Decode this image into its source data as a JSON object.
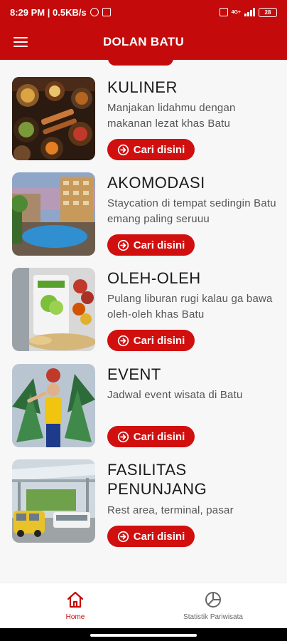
{
  "status_bar": {
    "time_speed": "8:29 PM | 0.5KB/s",
    "network_type": "4G+",
    "battery": "28"
  },
  "app_bar": {
    "title": "DOLAN BATU"
  },
  "cards": [
    {
      "title": "KULINER",
      "desc": "Manjakan lidahmu dengan makanan lezat khas Batu",
      "button": "Cari disini"
    },
    {
      "title": "AKOMODASI",
      "desc": "Staycation di tempat sedingin Batu emang paling seruuu",
      "button": "Cari disini"
    },
    {
      "title": "OLEH-OLEH",
      "desc": "Pulang liburan rugi kalau ga bawa oleh-oleh khas Batu",
      "button": "Cari disini"
    },
    {
      "title": "EVENT",
      "desc": "Jadwal event wisata di Batu",
      "button": "Cari disini"
    },
    {
      "title": "FASILITAS PENUNJANG",
      "desc": "Rest area, terminal, pasar",
      "button": "Cari disini"
    }
  ],
  "bottom_nav": {
    "items": [
      {
        "label": "Home",
        "icon": "home-icon",
        "active": true
      },
      {
        "label": "Statistik Pariwisata",
        "icon": "pie-chart-icon",
        "active": false
      }
    ]
  },
  "colors": {
    "primary": "#c40a0a",
    "button": "#d10f0f",
    "background": "#f7f7f7"
  }
}
